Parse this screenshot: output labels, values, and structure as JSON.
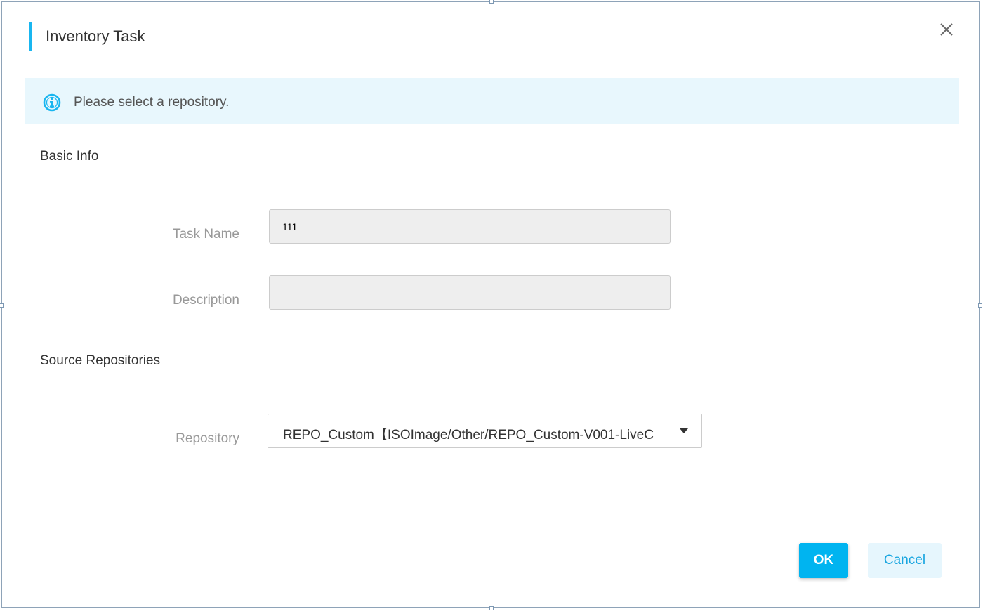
{
  "dialog": {
    "title": "Inventory Task",
    "close_icon": "close-icon",
    "accent_color": "#19b6f0"
  },
  "info_banner": {
    "icon": "info-icon",
    "text": "Please select a repository."
  },
  "basic_info": {
    "section_title": "Basic Info",
    "task_name": {
      "label": "Task Name",
      "value": "111",
      "placeholder": ""
    },
    "description": {
      "label": "Description",
      "value": "",
      "placeholder": ""
    }
  },
  "source_repositories": {
    "section_title": "Source Repositories",
    "repository": {
      "label": "Repository",
      "selected": "REPO_Custom【ISOImage/Other/REPO_Custom-V001-LiveC",
      "caret_icon": "caret-down-icon"
    }
  },
  "footer": {
    "ok_label": "OK",
    "cancel_label": "Cancel",
    "primary_color": "#00b4f0"
  }
}
